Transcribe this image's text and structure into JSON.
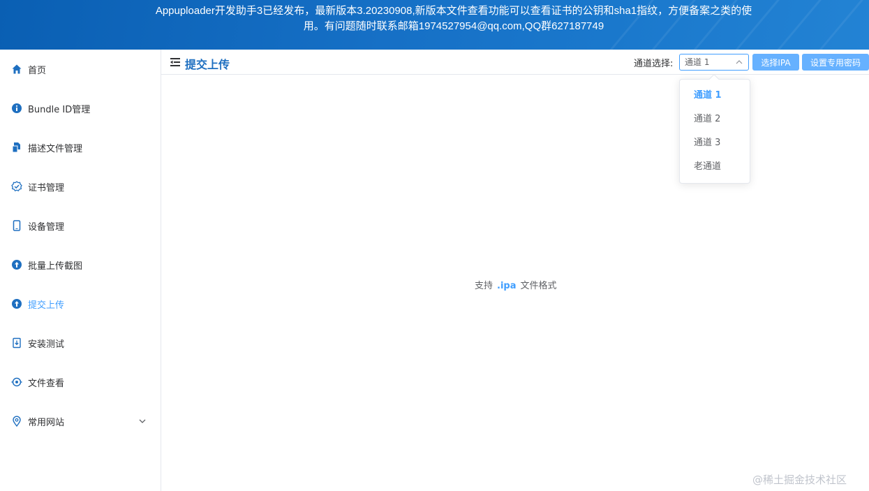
{
  "banner": {
    "line1": "Appuploader开发助手3已经发布，最新版本3.20230908,新版本文件查看功能可以查看证书的公钥和sha1指纹，方便备案之类的使",
    "line2": "用。有问题随时联系邮箱1974527954@qq.com,QQ群627187749"
  },
  "sidebar": {
    "items": [
      {
        "label": "首页",
        "icon": "home-icon"
      },
      {
        "label": "Bundle ID管理",
        "icon": "info-icon"
      },
      {
        "label": "描述文件管理",
        "icon": "files-icon"
      },
      {
        "label": "证书管理",
        "icon": "badge-check-icon"
      },
      {
        "label": "设备管理",
        "icon": "phone-icon"
      },
      {
        "label": "批量上传截图",
        "icon": "upload-icon"
      },
      {
        "label": "提交上传",
        "icon": "upload-icon"
      },
      {
        "label": "安装测试",
        "icon": "install-icon"
      },
      {
        "label": "文件查看",
        "icon": "view-icon"
      },
      {
        "label": "常用网站",
        "icon": "location-icon"
      }
    ],
    "active_index": 6
  },
  "header": {
    "title": "提交上传",
    "channel_label": "通道选择:",
    "channel_value": "通道 1",
    "select_ipa_label": "选择IPA",
    "set_password_label": "设置专用密码"
  },
  "dropdown": {
    "options": [
      "通道 1",
      "通道 2",
      "通道 3",
      "老通道"
    ],
    "selected_index": 0
  },
  "main": {
    "support_prefix": "支持",
    "support_ext": ".ipa",
    "support_suffix": "文件格式"
  },
  "watermark": "@稀土掘金技术社区",
  "colors": {
    "accent": "#409eff",
    "banner": "#1670c6",
    "title": "#1e6fc0"
  }
}
